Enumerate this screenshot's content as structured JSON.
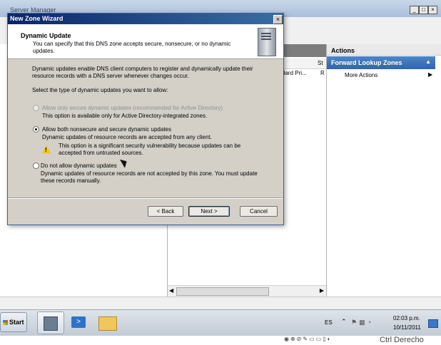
{
  "background_app": {
    "title": "Server Manager",
    "center_pane": {
      "column_head_fragment": "St",
      "row_fragment": "dard Pri...",
      "row_fragment2": "R"
    },
    "actions": {
      "title": "Actions",
      "section": "Forward Lookup Zones",
      "items": [
        {
          "label": "More Actions"
        }
      ]
    }
  },
  "wizard": {
    "title": "New Zone Wizard",
    "header": {
      "heading": "Dynamic Update",
      "desc_line1": "You can specify that this DNS zone accepts secure, nonsecure, or no dynamic",
      "desc_line2": "updates."
    },
    "intro_line1": "Dynamic updates enable DNS client computers to register and dynamically update their",
    "intro_line2": "resource records with a DNS server whenever changes occur.",
    "prompt": "Select the type of dynamic updates you want to allow:",
    "options": [
      {
        "label": "Allow only secure dynamic updates (recommended for Active Directory)",
        "desc": "This option is available only for Active Directory-integrated zones.",
        "selected": false,
        "disabled": true
      },
      {
        "label": "Allow both nonsecure and secure dynamic updates",
        "desc": "Dynamic updates of resource records are accepted from any client.",
        "warning_line1": "This option is a significant security vulnerability because updates can be",
        "warning_line2": "accepted from untrusted sources.",
        "selected": true,
        "disabled": false
      },
      {
        "label": "Do not allow dynamic updates",
        "desc_line1": "Dynamic updates of resource records are not accepted by this zone. You must update",
        "desc_line2": "these records manually.",
        "selected": false,
        "disabled": false
      }
    ],
    "buttons": {
      "back": "< Back",
      "next": "Next >",
      "cancel": "Cancel"
    }
  },
  "taskbar": {
    "start": "Start",
    "language": "ES",
    "time": "02:03 p.m.",
    "date": "10/11/2011"
  },
  "bottom_label": "Ctrl Derecho",
  "colors": {
    "title_gradient_start": "#0a246a",
    "title_gradient_end": "#3a6ea5",
    "dialog_face": "#d4d0c8",
    "actions_section": "#2f65ab"
  }
}
